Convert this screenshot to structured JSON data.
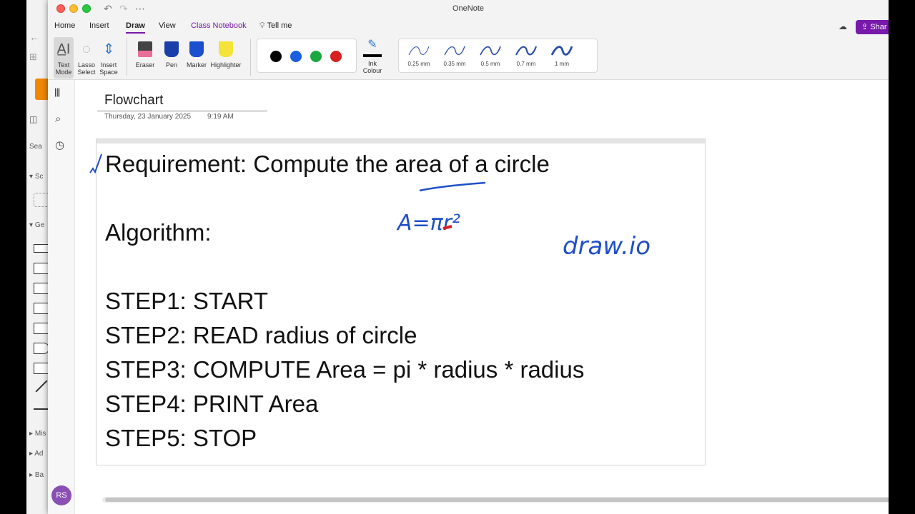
{
  "app": {
    "title": "OneNote",
    "share_label": "Shar"
  },
  "bg_app": {
    "search_label": "Sea",
    "sections": [
      "Sc",
      "Ge",
      "Mis",
      "Ad",
      "Ba"
    ]
  },
  "tabs": [
    {
      "label": "Home"
    },
    {
      "label": "Insert"
    },
    {
      "label": "Draw"
    },
    {
      "label": "View"
    },
    {
      "label": "Class Notebook"
    }
  ],
  "tell_me": "Tell me",
  "ribbon": {
    "text_mode": "Text\nMode",
    "lasso": "Lasso\nSelect",
    "insert_space": "Insert\nSpace",
    "eraser": "Eraser",
    "pen": "Pen",
    "marker": "Marker",
    "highlighter": "Highlighter",
    "ink_colour": "Ink\nColour",
    "pen_colors": [
      "#000000",
      "#1a5fe0",
      "#1aa83f",
      "#d92020"
    ],
    "thicknesses": [
      "0.25 mm",
      "0.35 mm",
      "0.5 mm",
      "0.7 mm",
      "1 mm"
    ]
  },
  "user": {
    "initials": "RS"
  },
  "page": {
    "title": "Flowchart",
    "date": "Thursday, 23 January 2025",
    "time": "9:19 AM",
    "lines": [
      "Requirement: Compute the area of a circle",
      "Algorithm:",
      "STEP1: START",
      "STEP2: READ radius of circle",
      "STEP3: COMPUTE Area = pi * radius * radius",
      "STEP4: PRINT Area",
      "STEP5: STOP"
    ]
  },
  "ink": {
    "formula": "A=πr²",
    "note": "draw.io",
    "color": "#1f4fc8",
    "accent": "#d92020"
  },
  "accent_color": "#7719aa"
}
